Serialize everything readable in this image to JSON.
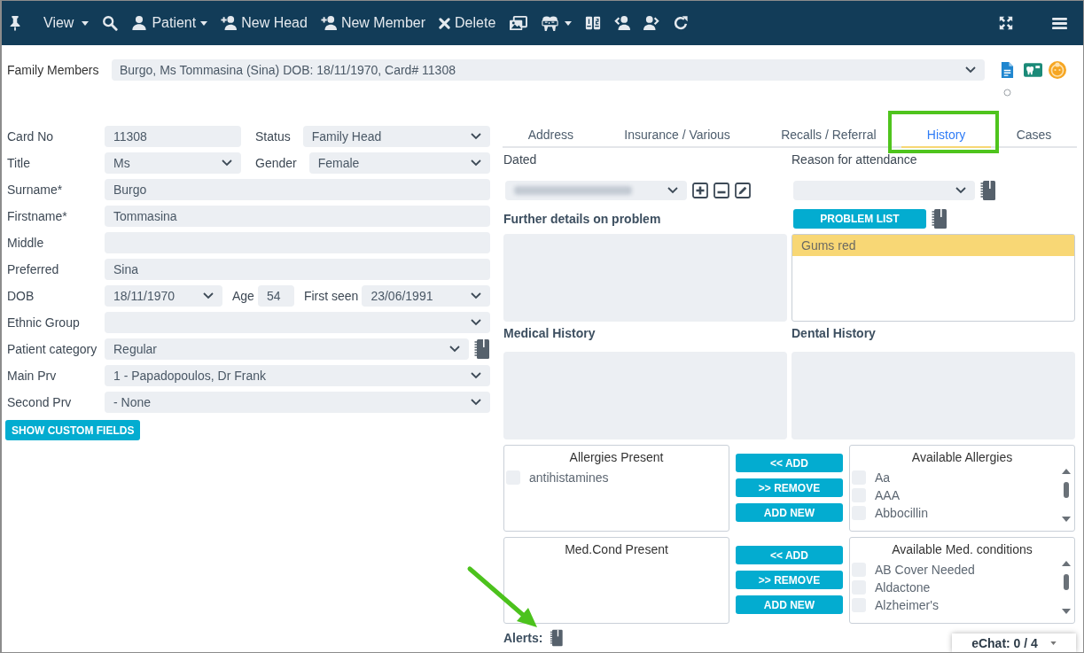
{
  "toolbar": {
    "menus": [
      {
        "label": "View",
        "dropdown": true
      },
      {
        "label": "Patient",
        "dropdown": true
      },
      {
        "label": "New Head",
        "dropdown": false
      },
      {
        "label": "New Member",
        "dropdown": false
      },
      {
        "label": "Delete",
        "dropdown": false
      }
    ]
  },
  "family_members": {
    "label": "Family Members",
    "value": "Burgo, Ms Tommasina (Sina) DOB: 18/11/1970, Card# 11308"
  },
  "patient_form": {
    "rows": [
      {
        "label": "Card No",
        "fields": [
          {
            "kind": "input",
            "value": "11308"
          },
          {
            "kind": "select",
            "label": "Status",
            "value": "Family Head"
          }
        ]
      },
      {
        "label": "Title",
        "fields": [
          {
            "kind": "select",
            "value": "Ms"
          },
          {
            "kind": "select",
            "label": "Gender",
            "value": "Female"
          }
        ]
      },
      {
        "label": "Surname*",
        "fields": [
          {
            "kind": "input",
            "value": "Burgo"
          }
        ]
      },
      {
        "label": "Firstname*",
        "fields": [
          {
            "kind": "input",
            "value": "Tommasina"
          }
        ]
      },
      {
        "label": "Middle",
        "fields": [
          {
            "kind": "input"
          }
        ]
      },
      {
        "label": "Preferred",
        "fields": [
          {
            "kind": "input",
            "value": "Sina"
          }
        ]
      },
      {
        "label": "DOB",
        "fields": [
          {
            "kind": "select",
            "value": "18/11/1970"
          },
          {
            "kind": "input",
            "label": "Age",
            "value": "54"
          },
          {
            "kind": "select",
            "label": "First seen",
            "value": "23/06/1991"
          }
        ]
      },
      {
        "label": "Ethnic Group",
        "fields": [
          {
            "kind": "select"
          }
        ]
      },
      {
        "label": "Patient category",
        "fields": [
          {
            "kind": "select",
            "value": "Regular",
            "notes": true
          }
        ]
      },
      {
        "label": "Main Prv",
        "fields": [
          {
            "kind": "select",
            "value": "1 - Papadopoulos, Dr Frank"
          }
        ]
      },
      {
        "label": "Second Prv",
        "fields": [
          {
            "kind": "select",
            "value": "- None"
          }
        ]
      }
    ],
    "button": "SHOW CUSTOM FIELDS"
  },
  "tabs": [
    {
      "label": "Address",
      "selected": false
    },
    {
      "label": "Insurance / Various",
      "selected": false
    },
    {
      "label": "Recalls / Referral",
      "selected": false
    },
    {
      "label": "History",
      "selected": true
    },
    {
      "label": "Cases",
      "selected": false
    }
  ],
  "history": {
    "dated": {
      "label": "Dated",
      "value_blurred": true
    },
    "reason": {
      "label": "Reason for attendance",
      "notes": true
    },
    "further_details": {
      "label": "Further details on problem"
    },
    "problem_list": {
      "button": "PROBLEM LIST",
      "notes": true,
      "items": [
        {
          "text": "Gums red",
          "selected": true
        }
      ]
    },
    "medical_history": {
      "label": "Medical History"
    },
    "dental_history": {
      "label": "Dental History"
    },
    "transfer_lists": [
      {
        "present": {
          "title": "Allergies Present",
          "items": [
            {
              "text": "antihistamines",
              "checked": false
            }
          ]
        },
        "buttons": [
          "<< ADD",
          ">> REMOVE",
          "ADD NEW"
        ],
        "available": {
          "title": "Available Allergies",
          "items": [
            {
              "text": "Aa",
              "checked": false
            },
            {
              "text": "AAA",
              "checked": false
            },
            {
              "text": "Abbocillin",
              "checked": false
            }
          ]
        }
      },
      {
        "present": {
          "title": "Med.Cond Present"
        },
        "buttons": [
          "<< ADD",
          ">> REMOVE",
          "ADD NEW"
        ],
        "available": {
          "title": "Available Med. conditions",
          "items": [
            {
              "text": "AB Cover Needed",
              "checked": false
            },
            {
              "text": "Aldactone",
              "checked": false
            },
            {
              "text": "Alzheimer's",
              "checked": false
            }
          ]
        }
      }
    ],
    "alerts": {
      "label": "Alerts:",
      "notes": true
    }
  },
  "echat": {
    "label": "eChat: 0 / 4"
  }
}
